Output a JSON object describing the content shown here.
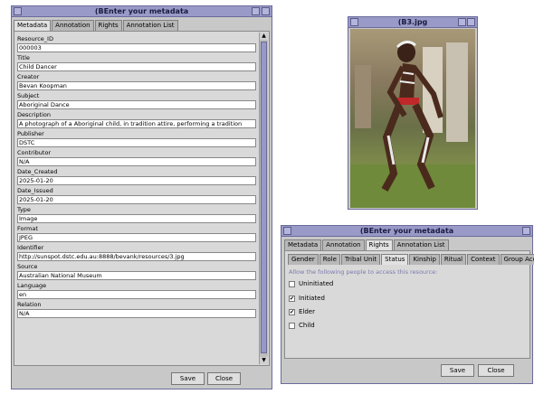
{
  "metadata_window": {
    "title": "(BEnter your metadata",
    "tabs": [
      {
        "label": "Metadata",
        "active": true
      },
      {
        "label": "Annotation",
        "active": false
      },
      {
        "label": "Rights",
        "active": false
      },
      {
        "label": "Annotation List",
        "active": false
      }
    ],
    "fields": [
      {
        "label": "Resource_ID",
        "value": "000003"
      },
      {
        "label": "Title",
        "value": "Child Dancer"
      },
      {
        "label": "Creator",
        "value": "Bevan Koopman"
      },
      {
        "label": "Subject",
        "value": "Aboriginal Dance"
      },
      {
        "label": "Description",
        "value": "A photograph of a Aboriginal child, in tradition attire, performing a tradition"
      },
      {
        "label": "Publisher",
        "value": "DSTC"
      },
      {
        "label": "Contributor",
        "value": "N/A"
      },
      {
        "label": "Date_Created",
        "value": "2025-01-20"
      },
      {
        "label": "Date_Issued",
        "value": "2025-01-20"
      },
      {
        "label": "Type",
        "value": "Image"
      },
      {
        "label": "Format",
        "value": "JPEG"
      },
      {
        "label": "Identifier",
        "value": "http://sunspot.dstc.edu.au:8888/bevank/resources/3.jpg"
      },
      {
        "label": "Source",
        "value": "Australian National Museum"
      },
      {
        "label": "Language",
        "value": "en"
      },
      {
        "label": "Relation",
        "value": "N/A"
      }
    ],
    "save_label": "Save",
    "close_label": "Close"
  },
  "image_window": {
    "title": "(B3.jpg"
  },
  "rights_window": {
    "title": "(BEnter your metadata",
    "tabs": [
      {
        "label": "Metadata",
        "active": false
      },
      {
        "label": "Annotation",
        "active": false
      },
      {
        "label": "Rights",
        "active": true
      },
      {
        "label": "Annotation List",
        "active": false
      }
    ],
    "subtabs": [
      {
        "label": "Gender",
        "active": false
      },
      {
        "label": "Role",
        "active": false
      },
      {
        "label": "Tribal Unit",
        "active": false
      },
      {
        "label": "Status",
        "active": true
      },
      {
        "label": "Kinship",
        "active": false
      },
      {
        "label": "Ritual",
        "active": false
      },
      {
        "label": "Context",
        "active": false
      },
      {
        "label": "Group Access",
        "active": false
      }
    ],
    "hint": "Allow the following people to access this resource:",
    "options": [
      {
        "label": "Uninitiated",
        "checked": false
      },
      {
        "label": "Initiated",
        "checked": true
      },
      {
        "label": "Elder",
        "checked": true
      },
      {
        "label": "Child",
        "checked": false
      }
    ],
    "save_label": "Save",
    "close_label": "Close"
  },
  "colors": {
    "titlebar": "#9a9ac8",
    "window_bg": "#c8c8c8",
    "panel_bg": "#d9d9d9",
    "hint_text": "#7a7ab0"
  }
}
